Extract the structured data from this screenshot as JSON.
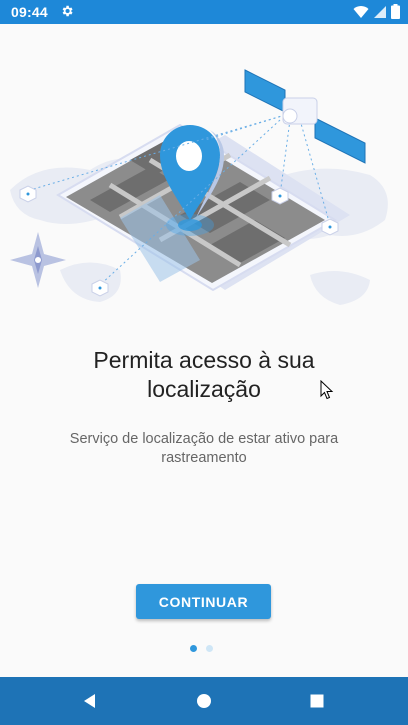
{
  "status_bar": {
    "time": "09:44",
    "icons": [
      "settings-icon",
      "wifi-icon",
      "signal-icon",
      "battery-icon"
    ],
    "color": "#1e88d8"
  },
  "onboarding": {
    "illustration": "location-permission-illustration",
    "title": "Permita acesso à sua localização",
    "subtitle": "Serviço de localização de estar ativo para rastreamento",
    "button_label": "CONTINUAR",
    "accent_color": "#2f97dc",
    "pager": {
      "total": 2,
      "current": 1
    }
  },
  "nav_bar": {
    "buttons": [
      "back-icon",
      "home-icon",
      "recents-icon"
    ],
    "color": "#1e73b6"
  }
}
